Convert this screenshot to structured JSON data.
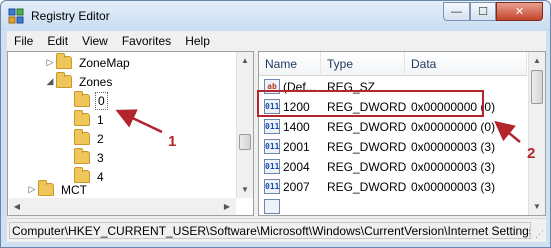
{
  "window": {
    "title": "Registry Editor",
    "minimize_glyph": "—",
    "maximize_glyph": "☐",
    "close_glyph": "✕"
  },
  "menu": [
    "File",
    "Edit",
    "View",
    "Favorites",
    "Help"
  ],
  "tree": {
    "items": [
      {
        "label": "ZoneMap",
        "arrow": "▷"
      },
      {
        "label": "Zones",
        "arrow": "◢"
      },
      {
        "label": "0",
        "arrow": ""
      },
      {
        "label": "1",
        "arrow": ""
      },
      {
        "label": "2",
        "arrow": ""
      },
      {
        "label": "3",
        "arrow": ""
      },
      {
        "label": "4",
        "arrow": ""
      },
      {
        "label": "MCT",
        "arrow": "▷"
      }
    ]
  },
  "list": {
    "columns": [
      "Name",
      "Type",
      "Data"
    ],
    "rows": [
      {
        "icon": "ab",
        "name": "(Def...",
        "type": "REG_SZ",
        "data": ""
      },
      {
        "icon": "011",
        "name": "1200",
        "type": "REG_DWORD",
        "data": "0x00000000 (0)"
      },
      {
        "icon": "011",
        "name": "1400",
        "type": "REG_DWORD",
        "data": "0x00000000 (0)"
      },
      {
        "icon": "011",
        "name": "2001",
        "type": "REG_DWORD",
        "data": "0x00000003 (3)"
      },
      {
        "icon": "011",
        "name": "2004",
        "type": "REG_DWORD",
        "data": "0x00000003 (3)"
      },
      {
        "icon": "011",
        "name": "2007",
        "type": "REG_DWORD",
        "data": "0x00000003 (3)"
      }
    ]
  },
  "annotations": {
    "callout1": "1",
    "callout2": "2",
    "color": "#b4242b"
  },
  "status": {
    "path": "Computer\\HKEY_CURRENT_USER\\Software\\Microsoft\\Windows\\CurrentVersion\\Internet Settings\\"
  }
}
